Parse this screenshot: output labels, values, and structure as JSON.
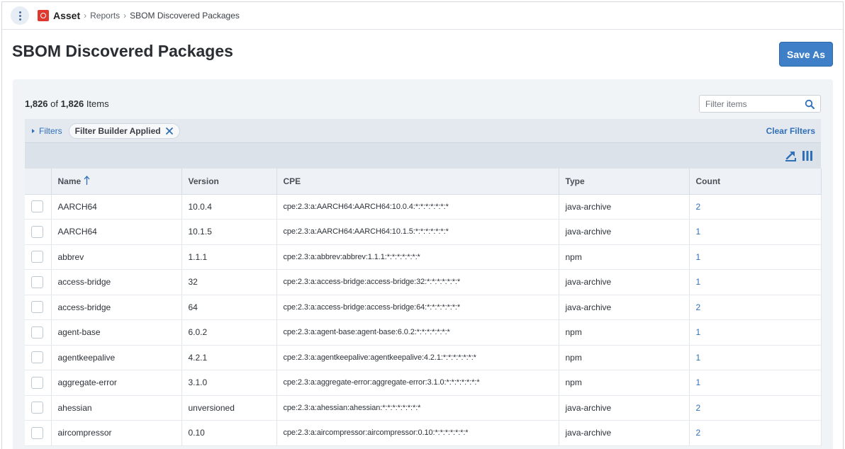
{
  "breadcrumb": {
    "app": "Asset",
    "items": [
      "Reports",
      "SBOM Discovered Packages"
    ]
  },
  "page": {
    "title": "SBOM Discovered Packages",
    "save_as_label": "Save As"
  },
  "summary": {
    "shown": "1,826",
    "of": "of",
    "total": "1,826",
    "unit": "Items"
  },
  "filter": {
    "placeholder": "Filter items",
    "toggle_label": "Filters",
    "chip_label": "Filter Builder Applied",
    "clear_label": "Clear Filters"
  },
  "table": {
    "columns": [
      "Name",
      "Version",
      "CPE",
      "Type",
      "Count"
    ],
    "sorted_column": "Name",
    "sort_direction": "ascending",
    "rows": [
      {
        "name": "AARCH64",
        "version": "10.0.4",
        "cpe": "cpe:2.3:a:AARCH64:AARCH64:10.0.4:*:*:*:*:*:*:*",
        "type": "java-archive",
        "count": "2"
      },
      {
        "name": "AARCH64",
        "version": "10.1.5",
        "cpe": "cpe:2.3:a:AARCH64:AARCH64:10.1.5:*:*:*:*:*:*:*",
        "type": "java-archive",
        "count": "1"
      },
      {
        "name": "abbrev",
        "version": "1.1.1",
        "cpe": "cpe:2.3:a:abbrev:abbrev:1.1.1:*:*:*:*:*:*:*",
        "type": "npm",
        "count": "1"
      },
      {
        "name": "access-bridge",
        "version": "32",
        "cpe": "cpe:2.3:a:access-bridge:access-bridge:32:*:*:*:*:*:*:*",
        "type": "java-archive",
        "count": "1"
      },
      {
        "name": "access-bridge",
        "version": "64",
        "cpe": "cpe:2.3:a:access-bridge:access-bridge:64:*:*:*:*:*:*:*",
        "type": "java-archive",
        "count": "2"
      },
      {
        "name": "agent-base",
        "version": "6.0.2",
        "cpe": "cpe:2.3:a:agent-base:agent-base:6.0.2:*:*:*:*:*:*:*",
        "type": "npm",
        "count": "1"
      },
      {
        "name": "agentkeepalive",
        "version": "4.2.1",
        "cpe": "cpe:2.3:a:agentkeepalive:agentkeepalive:4.2.1:*:*:*:*:*:*:*",
        "type": "npm",
        "count": "1"
      },
      {
        "name": "aggregate-error",
        "version": "3.1.0",
        "cpe": "cpe:2.3:a:aggregate-error:aggregate-error:3.1.0:*:*:*:*:*:*:*",
        "type": "npm",
        "count": "1"
      },
      {
        "name": "ahessian",
        "version": "unversioned",
        "cpe": "cpe:2.3:a:ahessian:ahessian:*:*:*:*:*:*:*:*",
        "type": "java-archive",
        "count": "2"
      },
      {
        "name": "aircompressor",
        "version": "0.10",
        "cpe": "cpe:2.3:a:aircompressor:aircompressor:0.10:*:*:*:*:*:*:*",
        "type": "java-archive",
        "count": "2"
      }
    ]
  },
  "colors": {
    "accent": "#3e7fc7",
    "link": "#2f6fb7",
    "app_logo": "#e0372f"
  },
  "icons": [
    "kebab-menu-icon",
    "app-logo-icon",
    "search-icon",
    "close-icon",
    "export-icon",
    "columns-icon",
    "sort-ascending-icon"
  ]
}
